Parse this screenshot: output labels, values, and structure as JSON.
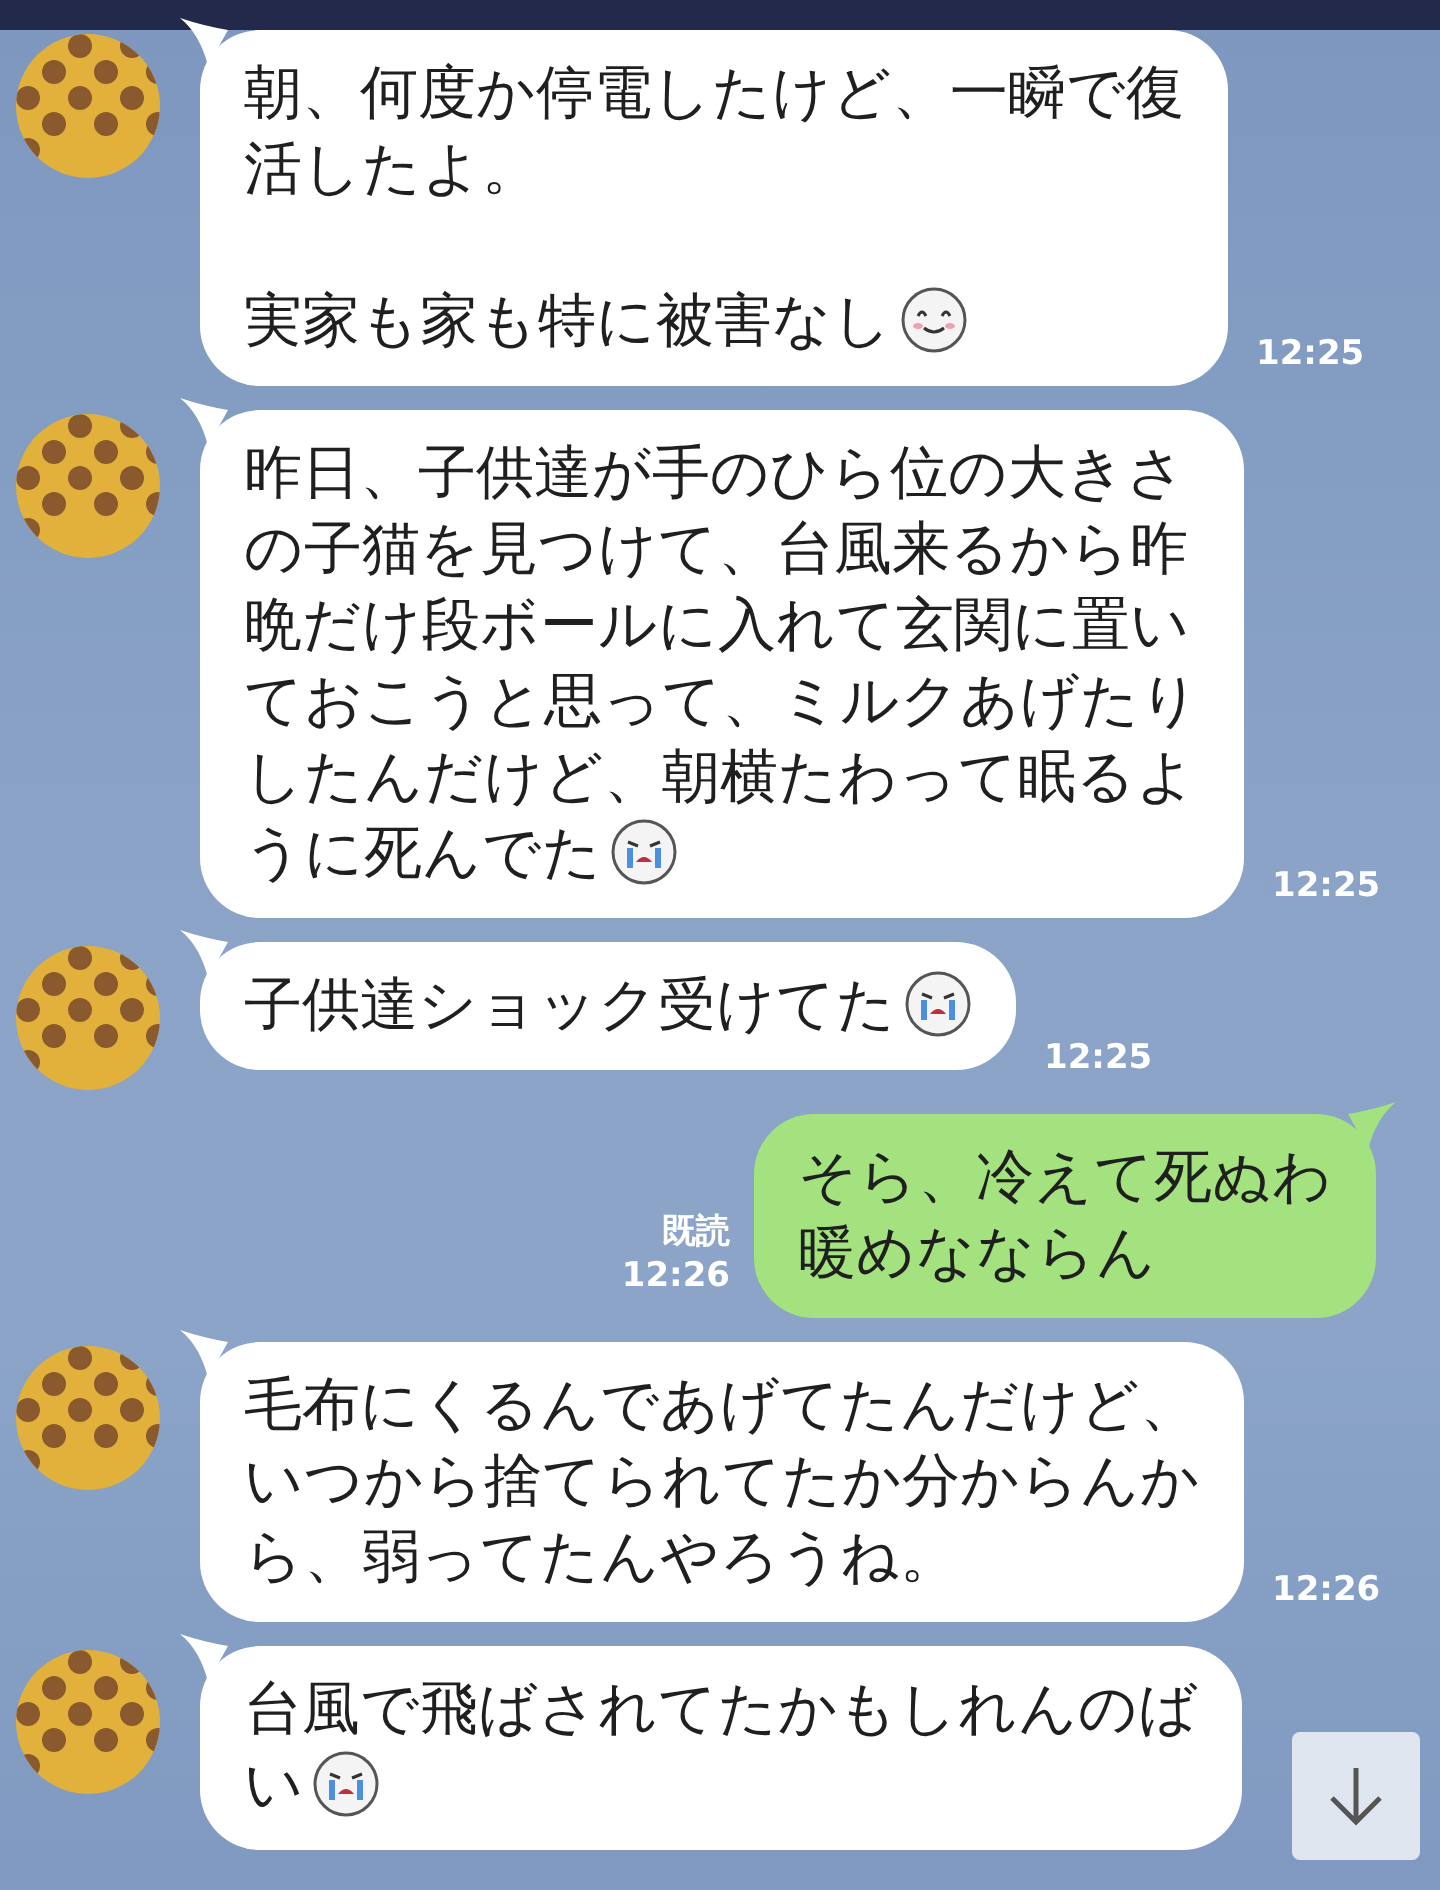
{
  "messages": [
    {
      "kind": "incoming",
      "paragraphs": [
        [
          "朝、何度か停電したけど、一瞬で復",
          "活したよ。"
        ],
        [
          "実家も家も特に被害なし"
        ]
      ],
      "emoji": {
        "kind": "smile"
      },
      "time": "12:25"
    },
    {
      "kind": "incoming",
      "paragraphs": [
        [
          "昨日、子供達が手のひら位の大きさ",
          "の子猫を見つけて、台風来るから昨",
          "晩だけ段ボールに入れて玄関に置い",
          "ておこうと思って、ミルクあげたり",
          "したんだけど、朝横たわって眠るよ",
          "うに死んでた"
        ]
      ],
      "emoji": {
        "kind": "cry"
      },
      "time": "12:25"
    },
    {
      "kind": "incoming",
      "paragraphs": [
        [
          "子供達ショック受けてた"
        ]
      ],
      "emoji": {
        "kind": "cry"
      },
      "time": "12:25"
    },
    {
      "kind": "outgoing",
      "paragraphs": [
        [
          "そら、冷えて死ぬわ",
          "暖めなならん"
        ]
      ],
      "read": "既読",
      "time": "12:26"
    },
    {
      "kind": "incoming",
      "paragraphs": [
        [
          "毛布にくるんであげてたんだけど、",
          "いつから捨てられてたか分からんか",
          "ら、弱ってたんやろうね。"
        ]
      ],
      "time": "12:26"
    },
    {
      "kind": "incoming",
      "paragraphs": [
        [
          "台風で飛ばされてたかもしれんのば",
          "い"
        ]
      ],
      "emoji": {
        "kind": "cry"
      }
    }
  ]
}
